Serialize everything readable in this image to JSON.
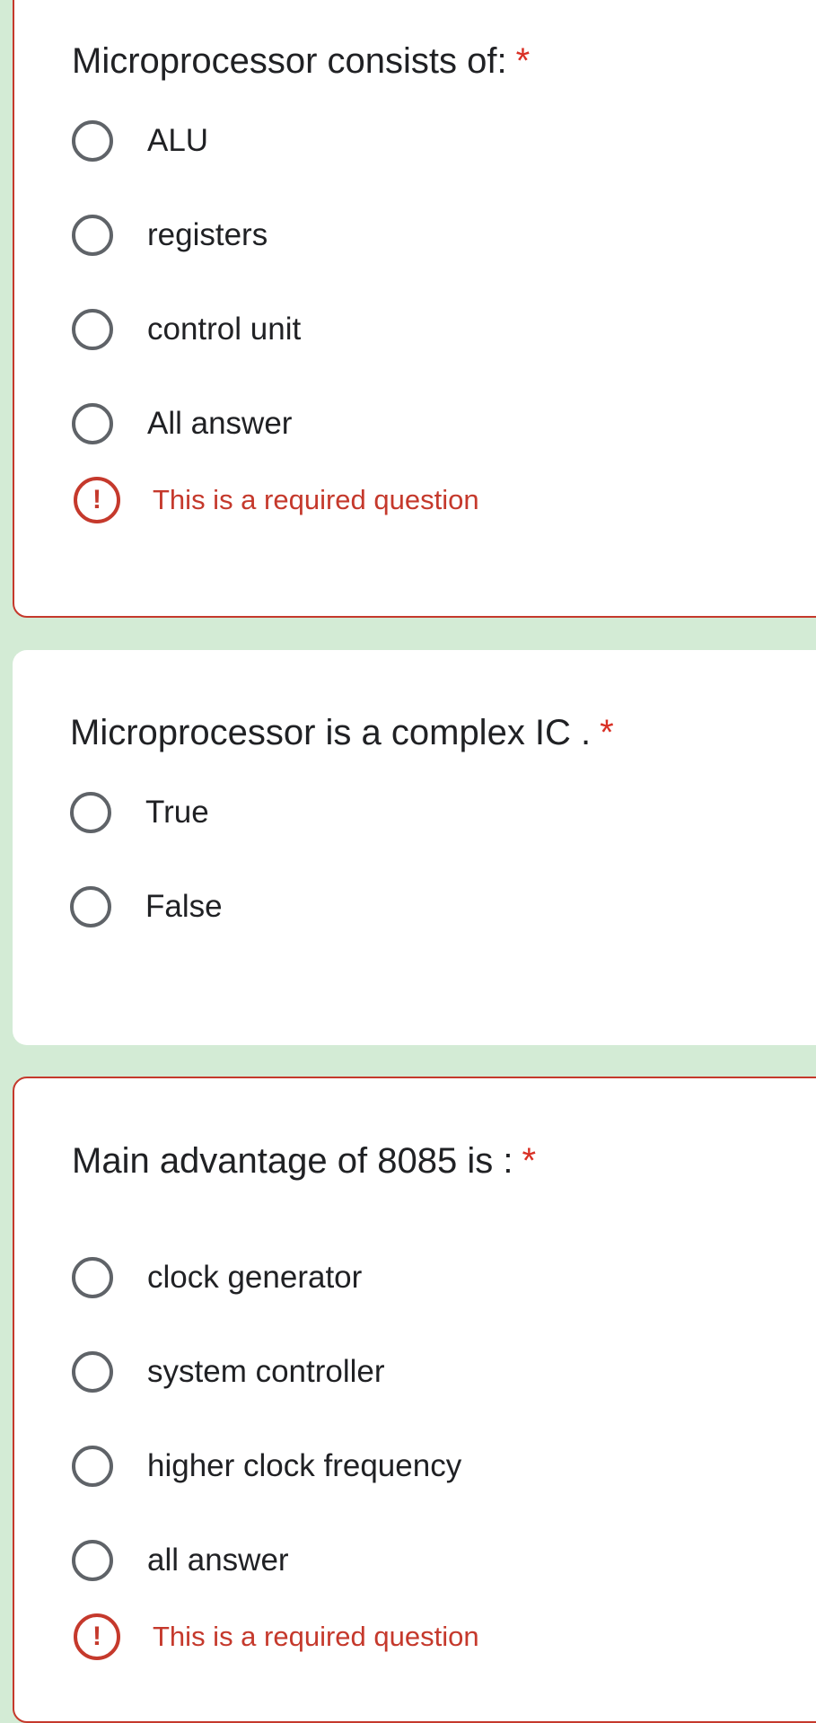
{
  "questions": [
    {
      "title": "Microprocessor consists of:",
      "required_mark": "*",
      "options": [
        "ALU",
        "registers",
        "control unit",
        "All answer"
      ],
      "error": "This is a required question",
      "error_icon": "exclamation-icon"
    },
    {
      "title": "Microprocessor is a complex IC .",
      "required_mark": "*",
      "options": [
        "True",
        "False"
      ]
    },
    {
      "title": "Main advantage of 8085 is :",
      "required_mark": "*",
      "options": [
        "clock generator",
        "system controller",
        "higher clock frequency",
        "all answer"
      ],
      "error": "This is a required question",
      "error_icon": "exclamation-icon"
    }
  ],
  "colors": {
    "background": "#d3ebd5",
    "error": "#c5392c",
    "required": "#d93025",
    "radio_border": "#5f6368"
  }
}
